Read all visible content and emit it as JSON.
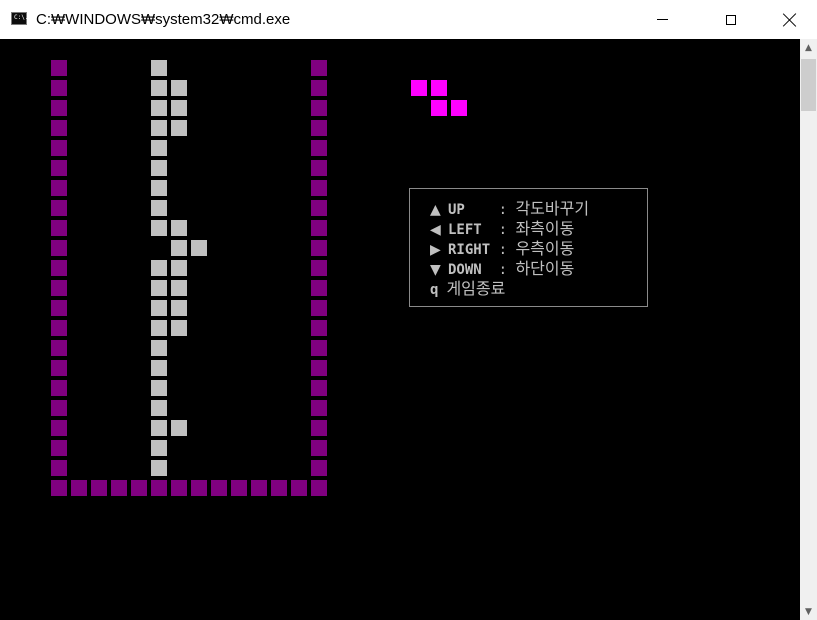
{
  "window": {
    "title": "C:₩WINDOWS₩system32₩cmd.exe",
    "icon_name": "cmd-icon",
    "icon_text": "C:\\.",
    "controls": {
      "minimize": "minimize-icon",
      "maximize": "maximize-icon",
      "close": "close-icon"
    }
  },
  "colors": {
    "background": "#000000",
    "wall": "#800080",
    "locked_block": "#c0c0c0",
    "falling_block": "#ff00ff",
    "help_text": "#c0c0c0",
    "help_border": "#8a8a8a"
  },
  "game": {
    "board": {
      "columns": 14,
      "rows": 22
    },
    "falling_piece": {
      "shape": "Z",
      "cells": [
        [
          0,
          0
        ],
        [
          1,
          0
        ],
        [
          1,
          1
        ],
        [
          2,
          1
        ]
      ]
    },
    "locked_cells": [
      [
        5,
        0
      ],
      [
        5,
        1
      ],
      [
        6,
        1
      ],
      [
        5,
        2
      ],
      [
        6,
        2
      ],
      [
        5,
        3
      ],
      [
        6,
        3
      ],
      [
        5,
        4
      ],
      [
        5,
        5
      ],
      [
        5,
        6
      ],
      [
        5,
        7
      ],
      [
        5,
        8
      ],
      [
        6,
        8
      ],
      [
        6,
        9
      ],
      [
        7,
        9
      ],
      [
        5,
        10
      ],
      [
        6,
        10
      ],
      [
        5,
        11
      ],
      [
        6,
        11
      ],
      [
        5,
        12
      ],
      [
        6,
        12
      ],
      [
        5,
        13
      ],
      [
        6,
        13
      ],
      [
        5,
        14
      ],
      [
        5,
        15
      ],
      [
        5,
        16
      ],
      [
        5,
        17
      ],
      [
        5,
        18
      ],
      [
        6,
        18
      ],
      [
        5,
        19
      ],
      [
        5,
        20
      ]
    ]
  },
  "help": {
    "lines": [
      {
        "icon": "up-triangle-icon",
        "glyph": "▲",
        "key": "UP   ",
        "sep": " : ",
        "desc": "각도바꾸기"
      },
      {
        "icon": "left-triangle-icon",
        "glyph": "◀",
        "key": "LEFT ",
        "sep": " : ",
        "desc": "좌측이동"
      },
      {
        "icon": "right-triangle-icon",
        "glyph": "▶",
        "key": "RIGHT",
        "sep": " : ",
        "desc": "우측이동"
      },
      {
        "icon": "down-triangle-icon",
        "glyph": "▼",
        "key": "DOWN ",
        "sep": " : ",
        "desc": "하단이동"
      }
    ],
    "quit": {
      "key": "q",
      "desc": "게임종료"
    }
  },
  "scrollbar": {
    "up_glyph": "▲",
    "down_glyph": "▼"
  }
}
